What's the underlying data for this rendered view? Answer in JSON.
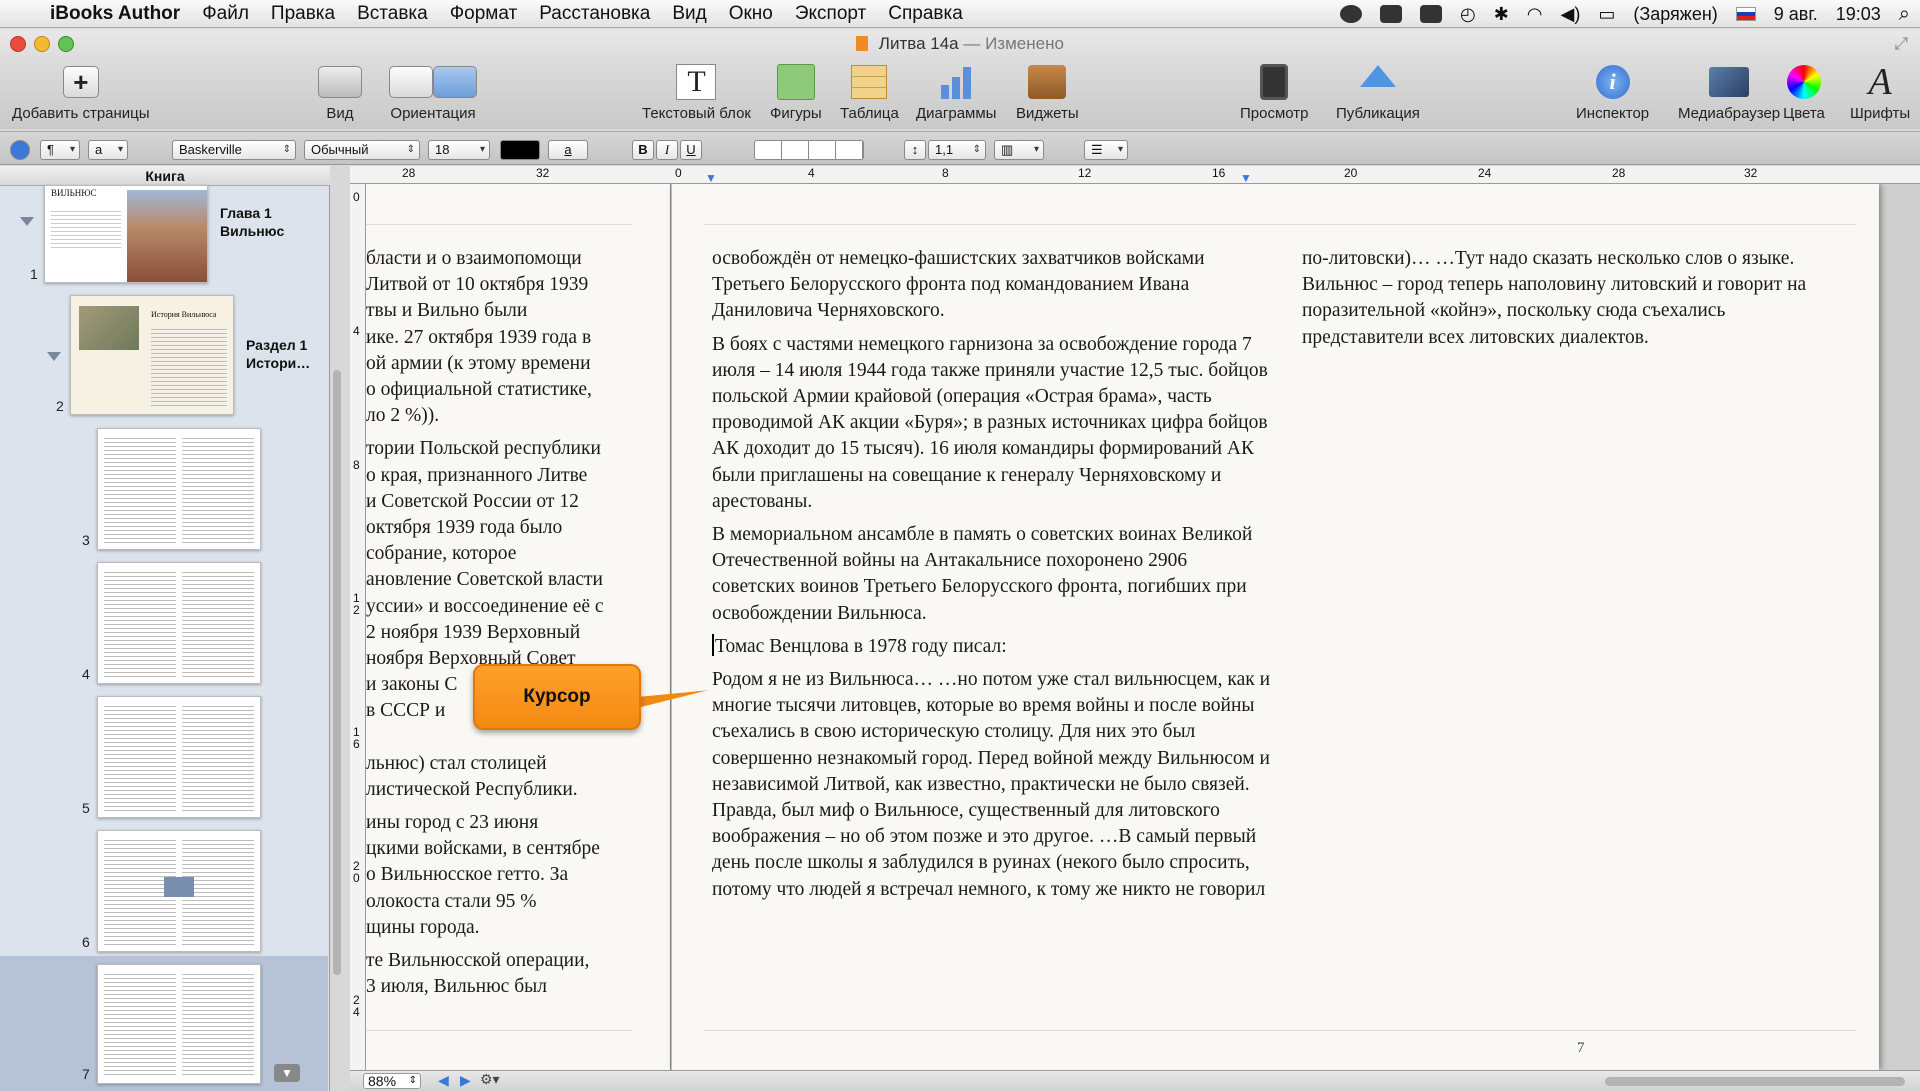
{
  "menubar": {
    "app_name": "iBooks Author",
    "items": [
      "Файл",
      "Правка",
      "Вставка",
      "Формат",
      "Расстановка",
      "Вид",
      "Окно",
      "Экспорт",
      "Справка"
    ],
    "battery_status": "(Заряжен)",
    "date": "9 авг.",
    "time": "19:03"
  },
  "window": {
    "title": "Литва 14а",
    "status": "— Изменено"
  },
  "toolbar": {
    "add_pages": "Добавить страницы",
    "view": "Вид",
    "orientation": "Ориентация",
    "text_block": "Текстовый блок",
    "shapes": "Фигуры",
    "table": "Таблица",
    "charts": "Диаграммы",
    "widgets": "Виджеты",
    "preview": "Просмотр",
    "publish": "Публикация",
    "inspector": "Инспектор",
    "media_browser": "Медиабраузер",
    "colors": "Цвета",
    "fonts": "Шрифты"
  },
  "formatbar": {
    "paragraph_style": "¶",
    "char_style": "a",
    "font_family": "Baskerville",
    "font_typeface": "Обычный",
    "font_size": "18",
    "text_color": "#000000",
    "highlight_label": "a",
    "bold": "B",
    "italic": "I",
    "underline": "U",
    "line_spacing": "1,1"
  },
  "sidebar": {
    "header": "Книга",
    "chapter_title": "Глава 1",
    "chapter_subtitle": "Вильнюс",
    "section_title": "Раздел 1",
    "section_subtitle": "Истори…",
    "thumb1_heading": "ВИЛЬНЮС",
    "thumb2_heading": "История Вильнюса",
    "pages": [
      "1",
      "2",
      "3",
      "4",
      "5",
      "6",
      "7"
    ]
  },
  "rulers": {
    "h_ticks": [
      "28",
      "32",
      "0",
      "4",
      "8",
      "12",
      "16",
      "20",
      "24",
      "28",
      "32"
    ],
    "v_ticks": [
      "0",
      "4",
      "8",
      "1\n2",
      "1\n6",
      "2\n0",
      "2\n4"
    ]
  },
  "document": {
    "left_page_paragraphs": [
      "бласти и о взаимопомощи\nЛитвой от 10 октября 1939\nтвы и Вильно были\nике. 27 октября 1939 года в\nой армии (к этому времени\nо официальной статистике,\nло 2 %)).",
      "тории Польской республики\nо края, признанного Литве\nи Советской России от 12\nоктября 1939 года было\nсобрание, которое\nановление Советской власти\nуссии» и воссоединение её с\n2 ноября 1939 Верховный\nноября Верховный Совет\nи законы С\nв СССР и",
      "льнюс) стал столицей\nлистической Республики.",
      "ины город с 23 июня\nцкими войсками, в сентябре\nо Вильнюсское гетто. За\nолокоста стали 95 %\nщины города.",
      "те Вильнюсской операции,\n3 июля, Вильнюс был"
    ],
    "col1_paragraphs": [
      "освобождён от немецко-фашистских захватчиков войсками Третьего Белорусского фронта под командованием Ивана Даниловича Черняховского.",
      "В боях с частями немецкого гарнизона за освобождение города 7 июля – 14 июля 1944 года также приняли участие 12,5 тыс. бойцов польской Армии крайовой (операция «Острая брама», часть проводимой АК акции «Буря»; в разных источниках цифра бойцов АК доходит до 15 тысяч). 16 июля командиры формирований АК были приглашены на совещание к генералу Черняховскому и арестованы.",
      "В мемориальном ансамбле в память о советских воинах Великой Отечественной войны на Антакальнисе похоронено 2906 советских воинов Третьего Белорусского фронта, погибших при освобождении Вильнюса.",
      "Томас Венцлова в 1978 году писал:",
      "Родом я не из Вильнюса… …но потом уже стал вильнюсцем, как и многие тысячи литовцев, которые во время войны и после войны съехались в свою историческую столицу. Для них это был совершенно незнакомый город. Перед войной между Вильнюсом и независимой Литвой, как известно, практически не было связей. Правда, был миф о Вильнюсе, существенный для литовского воображения – но об этом позже и это другое. …В самый первый день после школы я заблудился в руинах (некого было спросить, потому что людей я встречал немного, к тому же никто не говорил"
    ],
    "col2_paragraphs": [
      "по-литовски)… …Тут надо сказать несколько слов о языке. Вильнюс – город теперь наполовину литовский и говорит на поразительной «койнэ», поскольку сюда съехались представители всех литовских диалектов."
    ],
    "page_number": "7"
  },
  "callout": {
    "label": "Курсор",
    "color": "#f59214"
  },
  "statusbar": {
    "zoom": "88%"
  }
}
